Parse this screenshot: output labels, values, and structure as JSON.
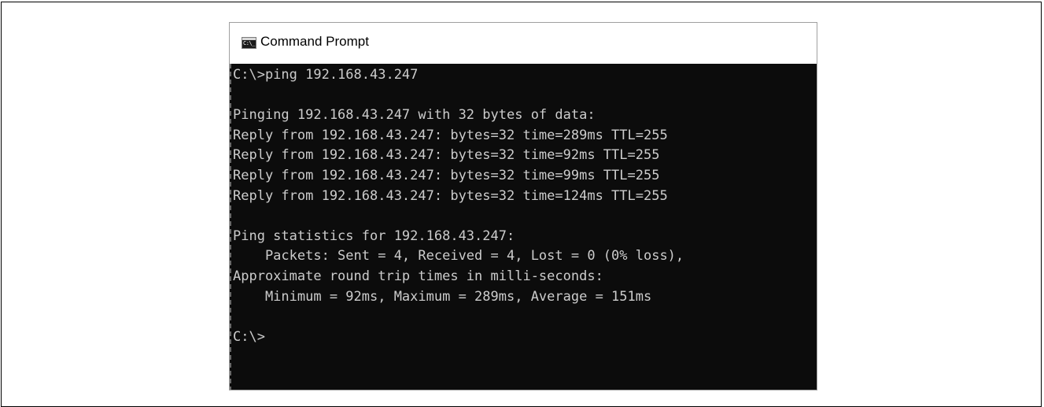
{
  "window": {
    "title": "Command Prompt",
    "icon": "cmd-icon"
  },
  "console": {
    "lines": [
      "C:\\>ping 192.168.43.247",
      "",
      "Pinging 192.168.43.247 with 32 bytes of data:",
      "Reply from 192.168.43.247: bytes=32 time=289ms TTL=255",
      "Reply from 192.168.43.247: bytes=32 time=92ms TTL=255",
      "Reply from 192.168.43.247: bytes=32 time=99ms TTL=255",
      "Reply from 192.168.43.247: bytes=32 time=124ms TTL=255",
      "",
      "Ping statistics for 192.168.43.247:",
      "    Packets: Sent = 4, Received = 4, Lost = 0 (0% loss),",
      "Approximate round trip times in milli-seconds:",
      "    Minimum = 92ms, Maximum = 289ms, Average = 151ms",
      "",
      "C:\\>"
    ]
  },
  "colors": {
    "console_background": "#0c0c0c",
    "console_text": "#cccccc"
  }
}
